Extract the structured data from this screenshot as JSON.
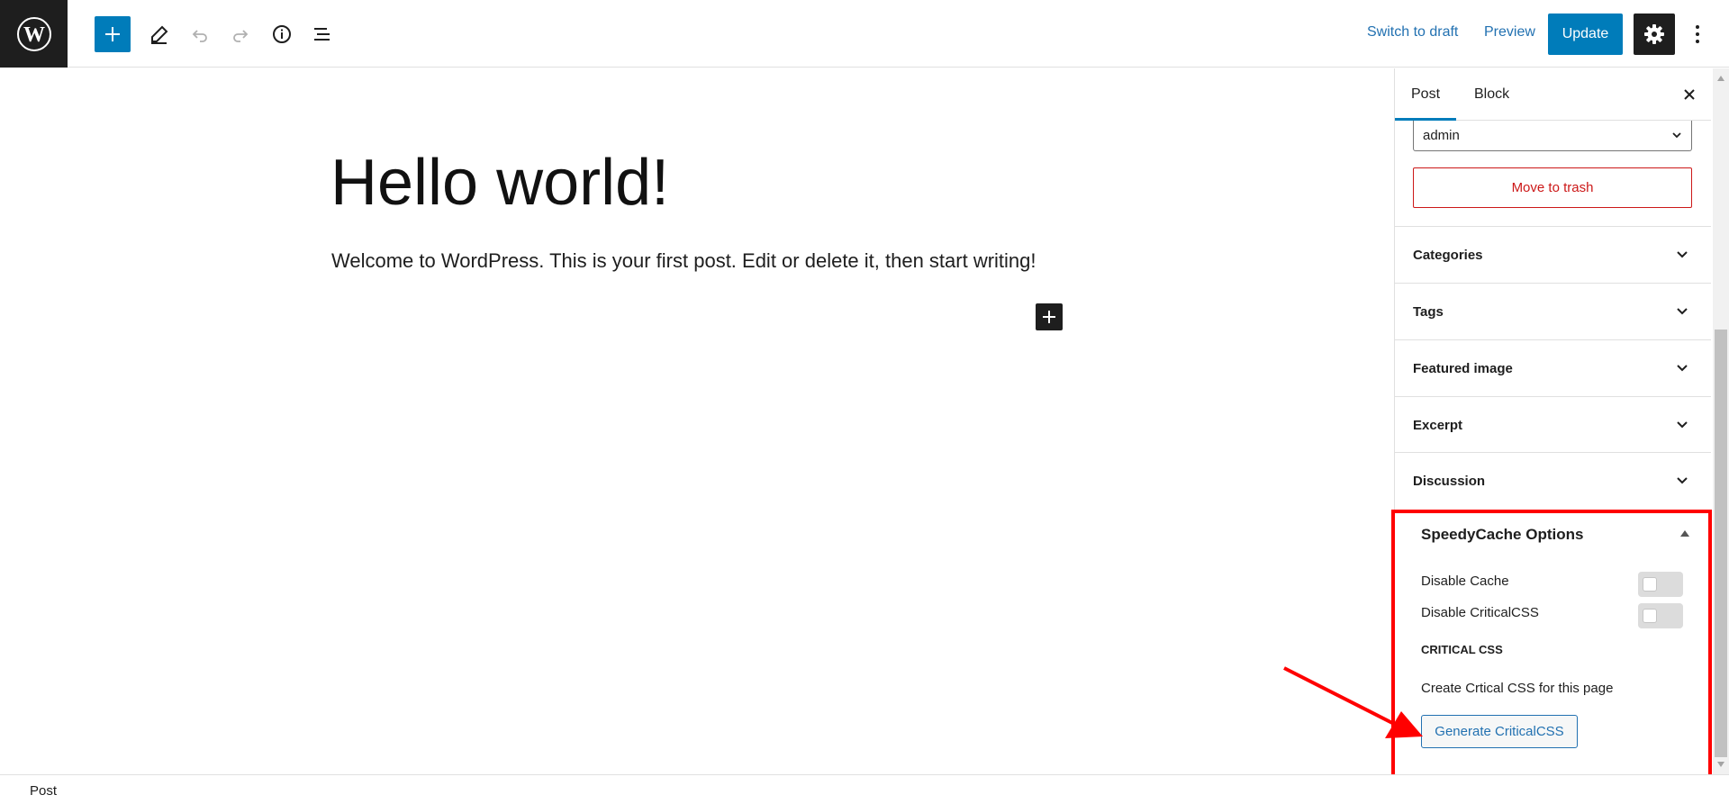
{
  "toolbar": {
    "switch_to_draft": "Switch to draft",
    "preview": "Preview",
    "update": "Update"
  },
  "post": {
    "title": "Hello world!",
    "paragraph": "Welcome to WordPress. This is your first post. Edit or delete it, then start writing!"
  },
  "sidebar": {
    "tabs": [
      {
        "label": "Post",
        "active": true
      },
      {
        "label": "Block",
        "active": false
      }
    ],
    "author_value": "admin",
    "trash_label": "Move to trash",
    "panels": [
      "Categories",
      "Tags",
      "Featured image",
      "Excerpt",
      "Discussion"
    ]
  },
  "speedycache": {
    "title": "SpeedyCache Options",
    "disable_cache": "Disable Cache",
    "disable_criticalcss": "Disable CriticalCSS",
    "section": "CRITICAL CSS",
    "description": "Create Crtical CSS for this page",
    "generate_button": "Generate CriticalCSS"
  },
  "footer": {
    "breadcrumb": "Post"
  },
  "colors": {
    "accent": "#007cba",
    "danger": "#cc1818",
    "highlight": "#ff0000"
  }
}
